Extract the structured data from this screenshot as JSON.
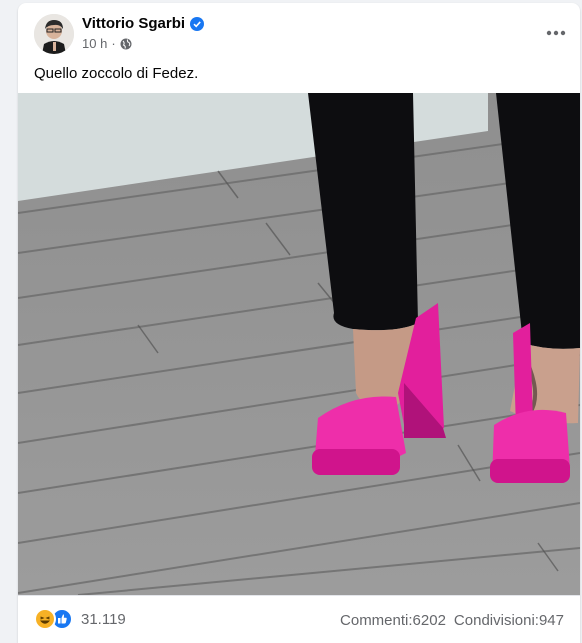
{
  "post": {
    "author": "Vittorio Sgarbi",
    "time": "10 h",
    "separator": "·",
    "caption": "Quello zoccolo di Fedez.",
    "icons": {
      "verified": "verified-badge-icon",
      "audience": "globe-icon",
      "more": "more-options-icon"
    }
  },
  "footer": {
    "reaction_count": "31.119",
    "reaction_icons": [
      "haha-icon",
      "like-icon"
    ],
    "comments_label": "Commenti",
    "comments_value": "6202",
    "shares_label": "Condivisioni",
    "shares_value": "947"
  },
  "colors": {
    "accent": "#1877f2",
    "shoe": "#e21f9c",
    "text_secondary": "#65676b"
  }
}
